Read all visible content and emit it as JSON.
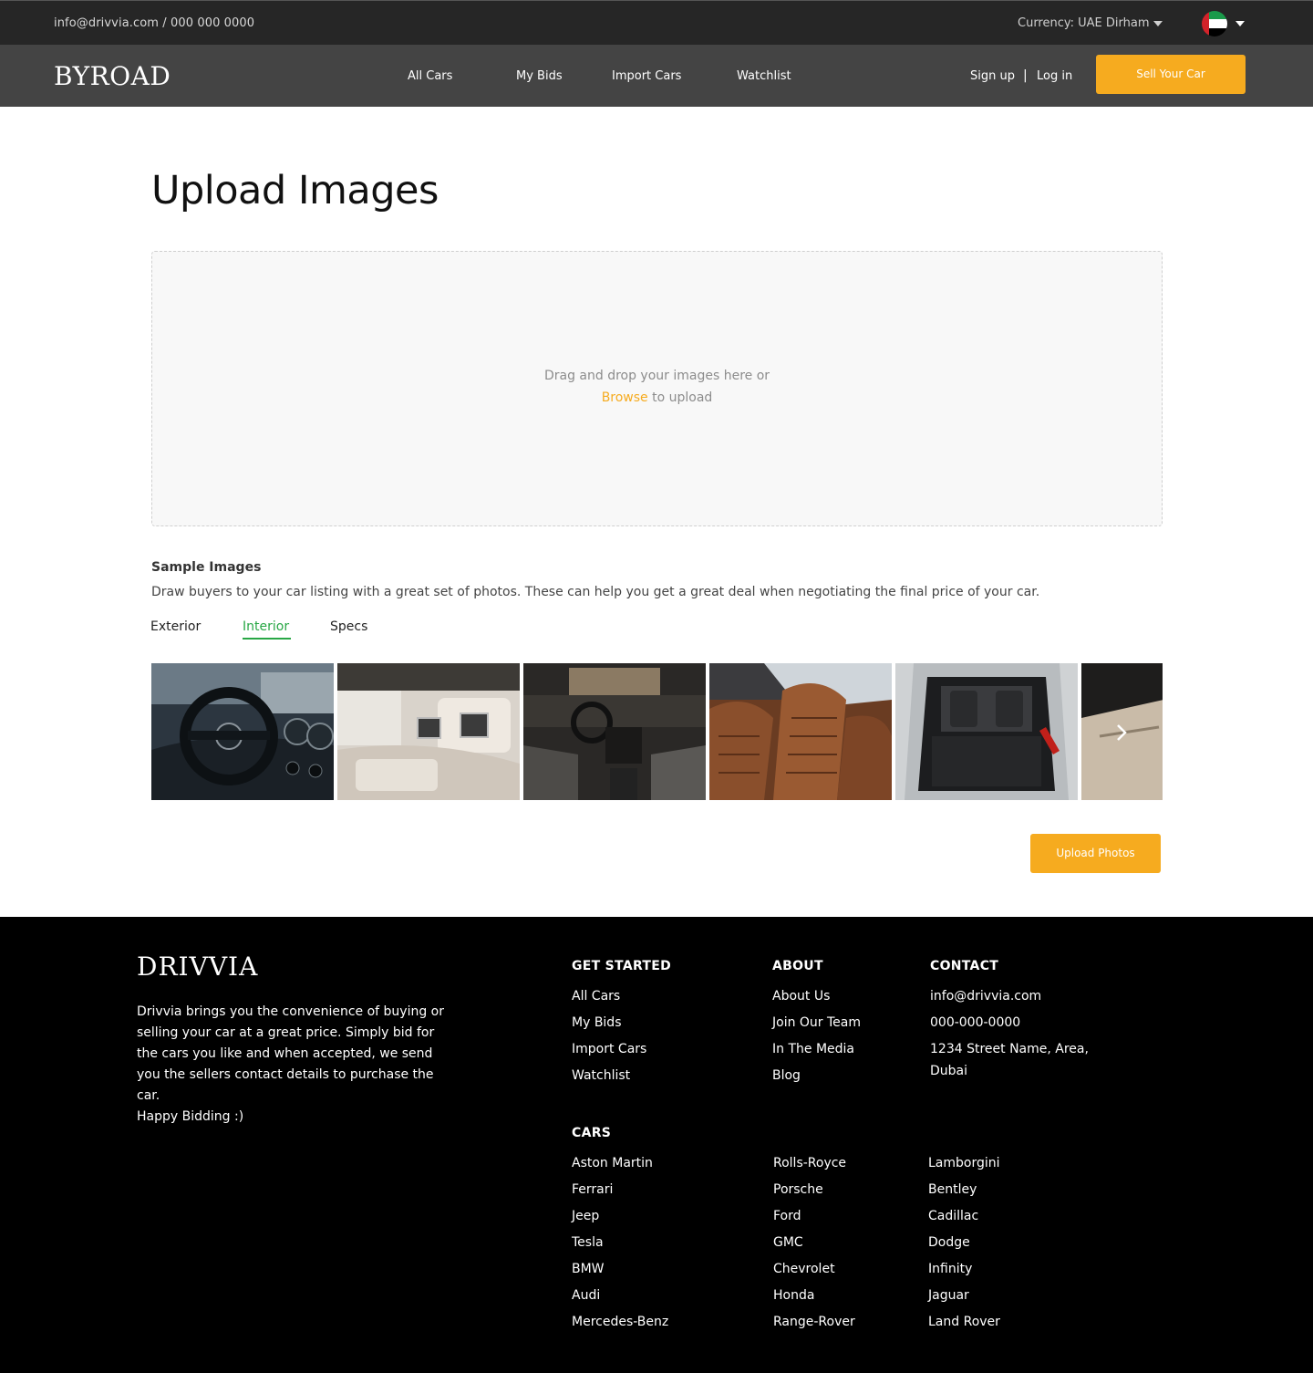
{
  "topbar": {
    "contact": "info@drivvia.com / 000 000 0000",
    "currency": "Currency: UAE Dirham"
  },
  "header": {
    "logo": "BYROAD",
    "nav": [
      "All Cars",
      "My Bids",
      "Import Cars",
      "Watchlist"
    ],
    "signup": "Sign up",
    "separator": "|",
    "login": "Log in",
    "sell_button": "Sell Your Car"
  },
  "main": {
    "title": "Upload Images",
    "dropzone": {
      "line1": "Drag and drop your images here or",
      "browse": "Browse",
      "line2_rest": " to upload"
    },
    "sample": {
      "title": "Sample Images",
      "description": "Draw buyers to your car listing with a great set of photos. These can help you get a great deal when negotiating the final price of your car."
    },
    "tabs": [
      "Exterior",
      "Interior",
      "Specs"
    ],
    "active_tab": "Interior",
    "thumbnails": [
      "steering-wheel-photo",
      "rear-seats-photo",
      "dashboard-photo",
      "leather-seats-photo",
      "trunk-photo",
      "door-interior-photo"
    ],
    "upload_button": "Upload Photos"
  },
  "footer": {
    "logo": "DRIVVIA",
    "about": "Drivvia brings you the convenience of buying or selling your car at a great price. Simply bid for the cars you like and when accepted, we send you the sellers contact details to purchase the car.",
    "happy": "Happy Bidding :)",
    "get_started": {
      "title": "GET STARTED",
      "items": [
        "All Cars",
        "My Bids",
        "Import Cars",
        "Watchlist"
      ]
    },
    "about_col": {
      "title": "ABOUT",
      "items": [
        "About Us",
        "Join Our Team",
        "In The Media",
        "Blog"
      ]
    },
    "contact": {
      "title": "CONTACT",
      "email": "info@drivvia.com",
      "phone": "000-000-0000",
      "address": "1234 Street Name, Area, Dubai"
    },
    "cars": {
      "title": "CARS",
      "col1": [
        "Aston Martin",
        "Ferrari",
        "Jeep",
        "Tesla",
        "BMW",
        "Audi",
        "Mercedes-Benz"
      ],
      "col2": [
        "Rolls-Royce",
        "Porsche",
        "Ford",
        "GMC",
        "Chevrolet",
        "Honda",
        "Range-Rover"
      ],
      "col3": [
        "Lamborgini",
        "Bentley",
        "Cadillac",
        "Dodge",
        "Infinity",
        "Jaguar",
        "Land Rover"
      ]
    }
  },
  "colors": {
    "accent": "#f6ab1f",
    "active_tab": "#28a745",
    "topbar_bg": "#262626",
    "nav_bg": "#444444",
    "footer_bg": "#000000"
  },
  "icons": [
    "caret-down-icon",
    "uae-flag-icon",
    "chevron-right-icon"
  ]
}
